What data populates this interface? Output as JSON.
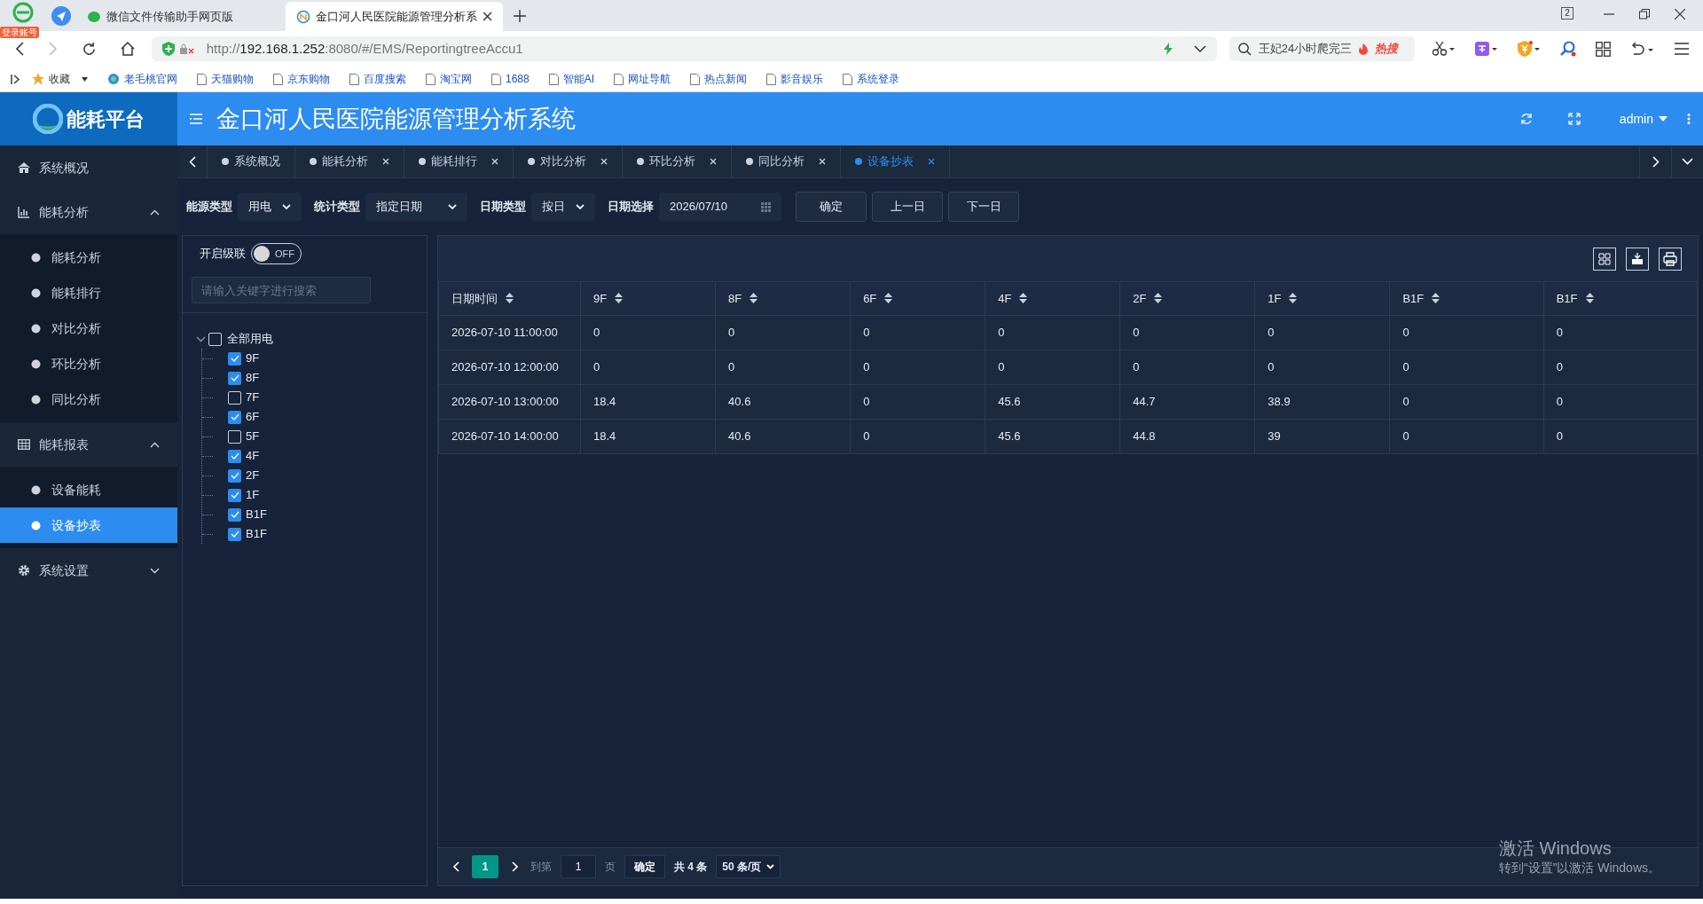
{
  "browser": {
    "login_badge": "登录账号",
    "tabs": [
      {
        "title": "微信文件传输助手网页版",
        "selected": false,
        "kind": "chat"
      },
      {
        "title": "金口河人民医院能源管理分析系",
        "selected": true,
        "kind": "site"
      }
    ],
    "tab_count": "2",
    "url": {
      "scheme": "http://",
      "host": "192.168.1.252",
      "path": ":8080/#/EMS/ReportingtreeAccu1"
    },
    "search": {
      "value": "王妃24小时爬完三",
      "hot": "热搜"
    },
    "bookmarks": [
      {
        "label": "收藏",
        "kind": "star"
      },
      {
        "label": "老毛桃官网",
        "kind": "site"
      },
      {
        "label": "天猫购物",
        "kind": "page"
      },
      {
        "label": "京东购物",
        "kind": "page"
      },
      {
        "label": "百度搜索",
        "kind": "page"
      },
      {
        "label": "淘宝网",
        "kind": "page"
      },
      {
        "label": "1688",
        "kind": "page"
      },
      {
        "label": "智能AI",
        "kind": "page"
      },
      {
        "label": "网址导航",
        "kind": "page"
      },
      {
        "label": "热点新闻",
        "kind": "page"
      },
      {
        "label": "影音娱乐",
        "kind": "page"
      },
      {
        "label": "系统登录",
        "kind": "page"
      }
    ]
  },
  "app": {
    "logo": "能耗平台",
    "title": "金口河人民医院能源管理分析系统",
    "user": "admin"
  },
  "sidebar": [
    {
      "label": "系统概况",
      "selected": false
    },
    {
      "label": "能耗分析",
      "expanded": true,
      "selected": false,
      "children": [
        {
          "label": "能耗分析",
          "selected": false
        },
        {
          "label": "能耗排行",
          "selected": false
        },
        {
          "label": "对比分析",
          "selected": false
        },
        {
          "label": "环比分析",
          "selected": false
        },
        {
          "label": "同比分析",
          "selected": false
        }
      ]
    },
    {
      "label": "能耗报表",
      "expanded": true,
      "selected": false,
      "children": [
        {
          "label": "设备能耗",
          "selected": false
        },
        {
          "label": "设备抄表",
          "selected": true
        }
      ]
    },
    {
      "label": "系统设置",
      "expanded": false,
      "selected": false
    }
  ],
  "page_tabs": [
    {
      "label": "系统概况",
      "selected": false,
      "closable": false
    },
    {
      "label": "能耗分析",
      "selected": false,
      "closable": true
    },
    {
      "label": "能耗排行",
      "selected": false,
      "closable": true
    },
    {
      "label": "对比分析",
      "selected": false,
      "closable": true
    },
    {
      "label": "环比分析",
      "selected": false,
      "closable": true
    },
    {
      "label": "同比分析",
      "selected": false,
      "closable": true
    },
    {
      "label": "设备抄表",
      "selected": true,
      "closable": true
    }
  ],
  "filters": [
    {
      "label": "能源类型",
      "value": "用电",
      "kind": "select"
    },
    {
      "label": "统计类型",
      "value": "指定日期",
      "kind": "select"
    },
    {
      "label": "日期类型",
      "value": "按日",
      "kind": "select"
    },
    {
      "label": "日期选择",
      "value": "2026/07/10",
      "kind": "date"
    }
  ],
  "buttons": [
    "确定",
    "上一日",
    "下一日"
  ],
  "tree": {
    "cascade_label": "开启级联",
    "cascade": {
      "on": false,
      "text": "OFF"
    },
    "search": {
      "placeholder": "请输入关键字进行搜索"
    },
    "root": {
      "label": "全部用电",
      "checked": false,
      "expanded": true,
      "children": [
        {
          "label": "9F",
          "checked": true
        },
        {
          "label": "8F",
          "checked": true
        },
        {
          "label": "7F",
          "checked": false
        },
        {
          "label": "6F",
          "checked": true
        },
        {
          "label": "5F",
          "checked": false
        },
        {
          "label": "4F",
          "checked": true
        },
        {
          "label": "2F",
          "checked": true
        },
        {
          "label": "1F",
          "checked": true
        },
        {
          "label": "B1F",
          "checked": true
        },
        {
          "label": "B1F",
          "checked": true
        }
      ]
    }
  },
  "table": {
    "columns": [
      "日期时间",
      "9F",
      "8F",
      "6F",
      "4F",
      "2F",
      "1F",
      "B1F",
      "B1F"
    ],
    "rows": [
      [
        "2026-07-10 11:00:00",
        "0",
        "0",
        "0",
        "0",
        "0",
        "0",
        "0",
        "0"
      ],
      [
        "2026-07-10 12:00:00",
        "0",
        "0",
        "0",
        "0",
        "0",
        "0",
        "0",
        "0"
      ],
      [
        "2026-07-10 13:00:00",
        "18.4",
        "40.6",
        "0",
        "45.6",
        "44.7",
        "38.9",
        "0",
        "0"
      ],
      [
        "2026-07-10 14:00:00",
        "18.4",
        "40.6",
        "0",
        "45.6",
        "44.8",
        "39",
        "0",
        "0"
      ]
    ]
  },
  "pagination": {
    "pages": [
      {
        "label": "1",
        "selected": true
      }
    ],
    "goto_label": "到第",
    "goto_value": "1",
    "page_unit": "页",
    "confirm": "确定",
    "total": "共 4 条",
    "page_size": "50 条/页"
  },
  "os_notice": {
    "title": "激活 Windows",
    "text": "转到“设置”以激活 Windows。"
  }
}
